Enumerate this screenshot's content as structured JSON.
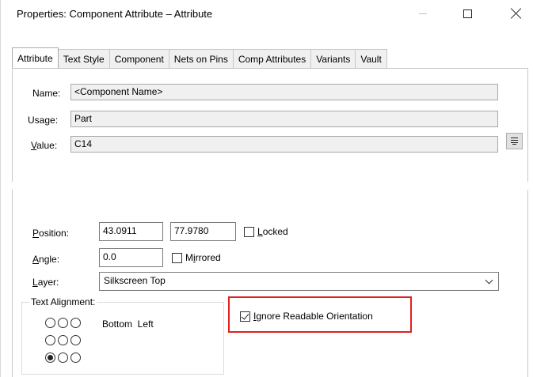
{
  "window": {
    "title": "Properties: Component Attribute – Attribute"
  },
  "tabs": [
    {
      "label": "Attribute",
      "active": true
    },
    {
      "label": "Text Style"
    },
    {
      "label": "Component"
    },
    {
      "label": "Nets on Pins"
    },
    {
      "label": "Comp Attributes"
    },
    {
      "label": "Variants"
    },
    {
      "label": "Vault"
    }
  ],
  "attribute": {
    "name_label": "Name:",
    "name_value": "<Component Name>",
    "usage_label": "Usage:",
    "usage_value": "Part",
    "value_label_first": "V",
    "value_label_rest": "alue:",
    "value_value": "C14"
  },
  "placement": {
    "position_label_first": "P",
    "position_label_rest": "osition:",
    "position_x": "43.0911",
    "position_y": "77.9780",
    "locked_first": "L",
    "locked_rest": "ocked",
    "locked_checked": false,
    "angle_label_first": "A",
    "angle_label_rest": "ngle:",
    "angle_value": "0.0",
    "mirrored_first": "M",
    "mirrored_mid": "i",
    "mirrored_rest": "rrored",
    "mirrored_checked": false,
    "layer_label_first": "L",
    "layer_label_rest": "ayer:",
    "layer_value": "Silkscreen Top"
  },
  "text_alignment": {
    "legend": "Text Alignment:",
    "selected_text": "Bottom  Left",
    "selected_index": 6
  },
  "ignore_readable": {
    "label_first": "I",
    "label_rest": "gnore Readable Orientation",
    "checked": true
  },
  "icons": [
    "minimize-icon",
    "maximize-icon",
    "close-icon",
    "ellipsis-icon",
    "chevron-down-icon",
    "checkbox-icon",
    "radio-icon"
  ],
  "colors": {
    "highlight": "#e32020",
    "readonly_bg": "#f0f0f0"
  }
}
